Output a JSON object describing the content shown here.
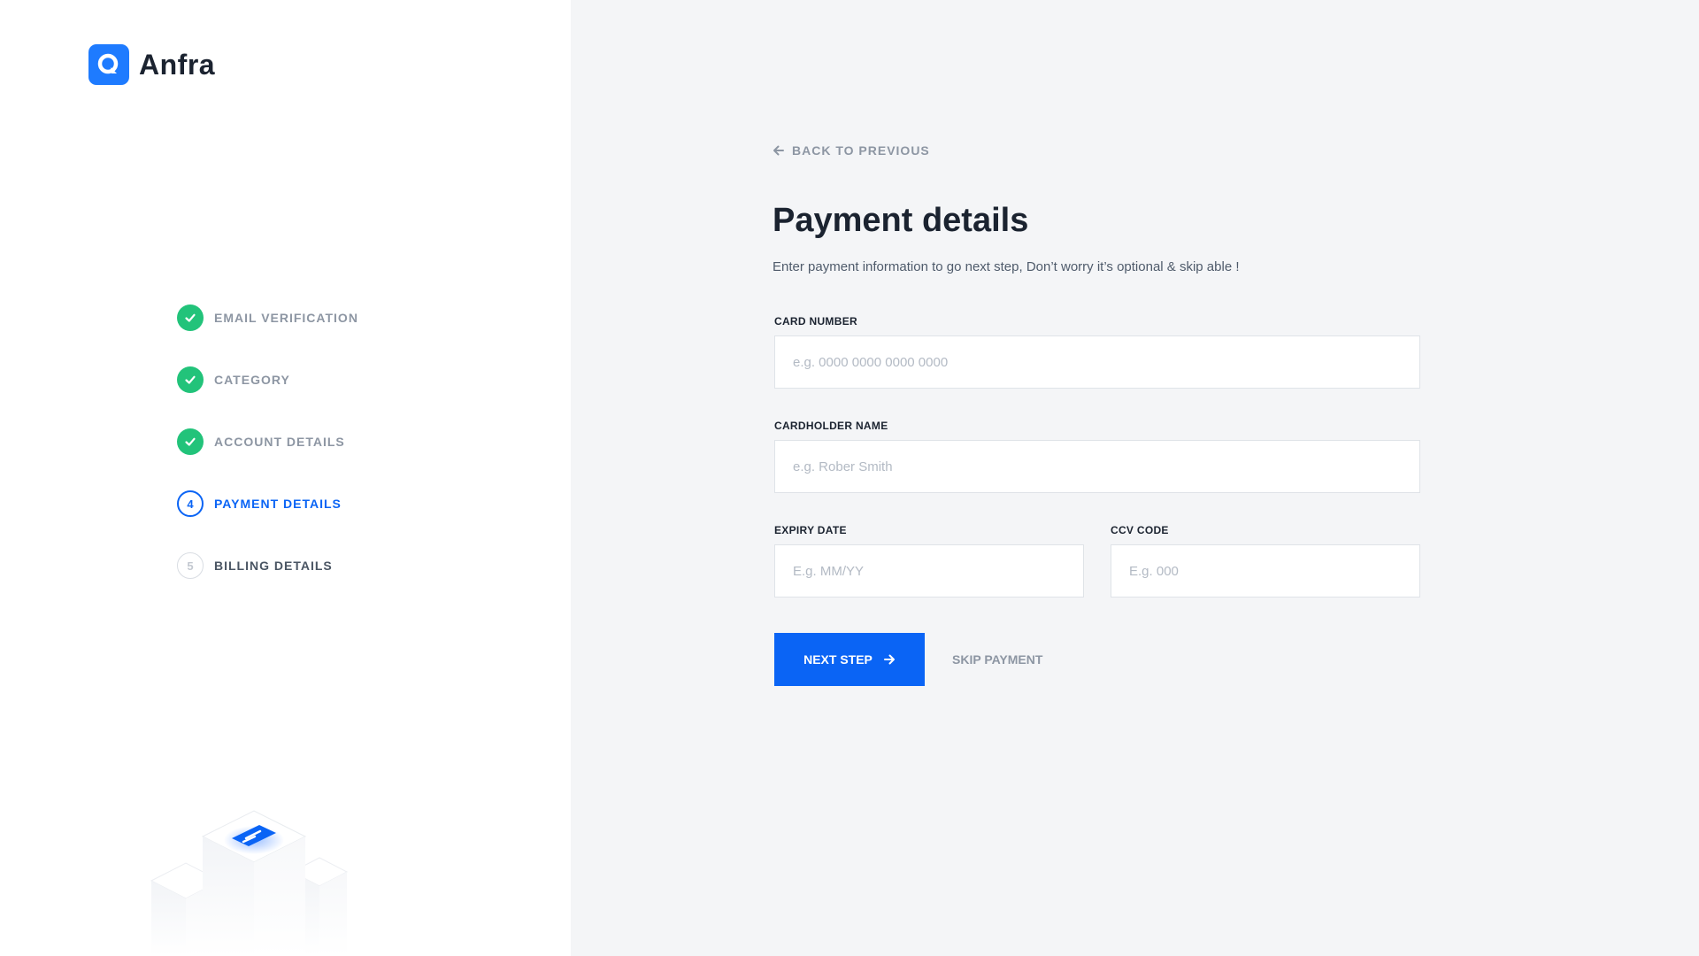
{
  "brand": {
    "name": "Anfra",
    "accent": "#0a64f5",
    "logo_color": "#1e7bff"
  },
  "steps": [
    {
      "label": "EMAIL VERIFICATION",
      "state": "done",
      "icon": "check-icon"
    },
    {
      "label": "CATEGORY",
      "state": "done",
      "icon": "check-icon"
    },
    {
      "label": "ACCOUNT DETAILS",
      "state": "done",
      "icon": "check-icon"
    },
    {
      "label": "PAYMENT DETAILS",
      "state": "active",
      "number": "4"
    },
    {
      "label": "BILLING DETAILS",
      "state": "pending",
      "number": "5"
    }
  ],
  "form": {
    "back_label": "BACK TO PREVIOUS",
    "title": "Payment details",
    "subtitle": "Enter payment information to go next step, Don’t worry it’s optional & skip able !",
    "card_number": {
      "label": "CARD NUMBER",
      "placeholder": "e.g. 0000 0000 0000 0000",
      "value": ""
    },
    "cardholder_name": {
      "label": "CARDHOLDER NAME",
      "placeholder": "e.g. Rober Smith",
      "value": ""
    },
    "expiry_date": {
      "label": "EXPIRY DATE",
      "placeholder": "E.g. MM/YY",
      "value": ""
    },
    "ccv_code": {
      "label": "CCV CODE",
      "placeholder": "E.g. 000",
      "value": ""
    },
    "next_label": "NEXT STEP",
    "skip_label": "SKIP PAYMENT"
  },
  "colors": {
    "done": "#22c37a",
    "active": "#0a64f5",
    "muted": "#8d96a3"
  }
}
